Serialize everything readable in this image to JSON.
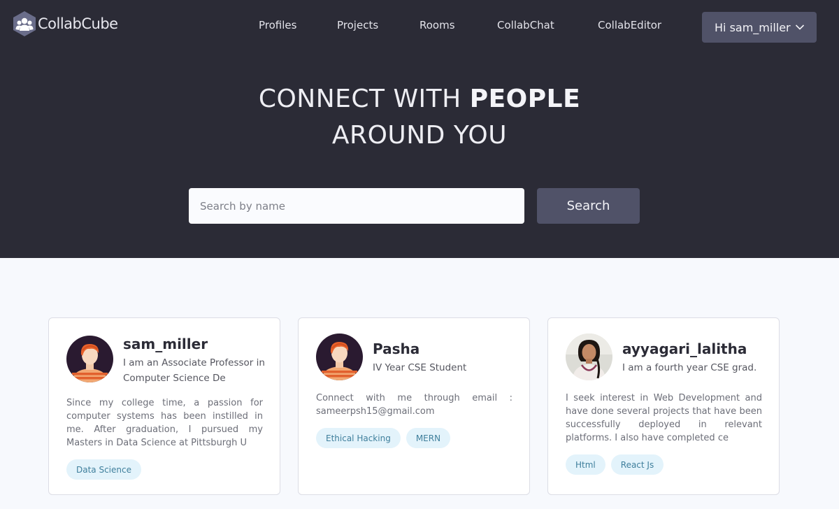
{
  "brand": {
    "name": "CollabCube"
  },
  "nav": {
    "links": [
      {
        "label": "Profiles"
      },
      {
        "label": "Projects"
      },
      {
        "label": "Rooms"
      },
      {
        "label": "CollabChat"
      },
      {
        "label": "CollabEditor"
      }
    ],
    "user_button": "Hi sam_miller"
  },
  "hero": {
    "title_light": "CONNECT WITH",
    "title_bold": "PEOPLE",
    "title_line2": "AROUND YOU"
  },
  "search": {
    "placeholder": "Search by name",
    "value": "",
    "button_label": "Search"
  },
  "profiles": [
    {
      "name": "sam_miller",
      "headline": "I am an Associate Professor in Computer Science De",
      "bio": "Since my college time, a passion for computer systems has been instilled in me. After graduation, I pursued my Masters in Data Science at Pittsburgh U",
      "tags": [
        "Data Science"
      ],
      "avatar": "male-illustration-avatar"
    },
    {
      "name": "Pasha",
      "headline": "IV Year CSE Student",
      "bio": "Connect with me through email : sameerpsh15@gmail.com",
      "tags": [
        "Ethical Hacking",
        "MERN"
      ],
      "avatar": "male-illustration-avatar"
    },
    {
      "name": "ayyagari_lalitha",
      "headline": "I am a fourth year CSE grad.",
      "bio": "I seek interest in Web Development and have done several projects that have been successfully deployed in relevant platforms. I also have completed ce",
      "tags": [
        "Html",
        "React Js"
      ],
      "avatar": "female-photo-avatar"
    }
  ],
  "colors": {
    "hero_bg": "#2b2b36",
    "accent_button": "#505268",
    "page_bg": "#f7f9fd",
    "tag_bg": "#e3f3fb",
    "tag_text": "#3f7f9c"
  }
}
